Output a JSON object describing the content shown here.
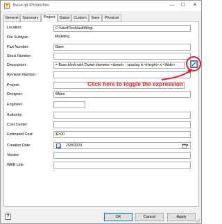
{
  "window": {
    "title": "Base.ipt iProperties",
    "icon": "inventor-part-icon"
  },
  "tabs": [
    {
      "label": "General"
    },
    {
      "label": "Summary"
    },
    {
      "label": "Project"
    },
    {
      "label": "Status"
    },
    {
      "label": "Custom"
    },
    {
      "label": "Save"
    },
    {
      "label": "Physical"
    }
  ],
  "active_tab": "Project",
  "fields": {
    "location": {
      "label": "Location:",
      "value": "C:\\Vault\\TestVault\\Blog\\"
    },
    "file_subtype": {
      "label": "File Subtype:",
      "value": "Modeling"
    },
    "part_number": {
      "label": "Part Number:",
      "value": "Base"
    },
    "stock_number": {
      "label": "Stock Number:",
      "value": ""
    },
    "description": {
      "label": "Description:",
      "value": "= Base block with Dowel diameter <dowel> ; spacing is <Height> x <Wide>"
    },
    "revision_number": {
      "label": "Revision Number:",
      "value": ""
    },
    "project": {
      "label": "Project:",
      "value": ""
    },
    "designer": {
      "label": "Designer:",
      "value": "Bfriee"
    },
    "engineer": {
      "label": "Engineer:",
      "value": ""
    },
    "authority": {
      "label": "Authority:",
      "value": ""
    },
    "cost_center": {
      "label": "Cost Center:",
      "value": ""
    },
    "estimated_cost": {
      "label": "Estimated Cost:",
      "value": "$0.00"
    },
    "creation_date": {
      "label": "Creation Date:",
      "value": "2/28/2020",
      "checked": true
    },
    "vendor": {
      "label": "Vendor:",
      "value": ""
    },
    "web_link": {
      "label": "WEB Link:",
      "value": ""
    }
  },
  "annotation": {
    "text": "Click here to toggle the expression",
    "color": "#e0202a"
  },
  "buttons": {
    "ok": "OK",
    "cancel": "Cancel",
    "apply": "Apply",
    "help": "?"
  }
}
